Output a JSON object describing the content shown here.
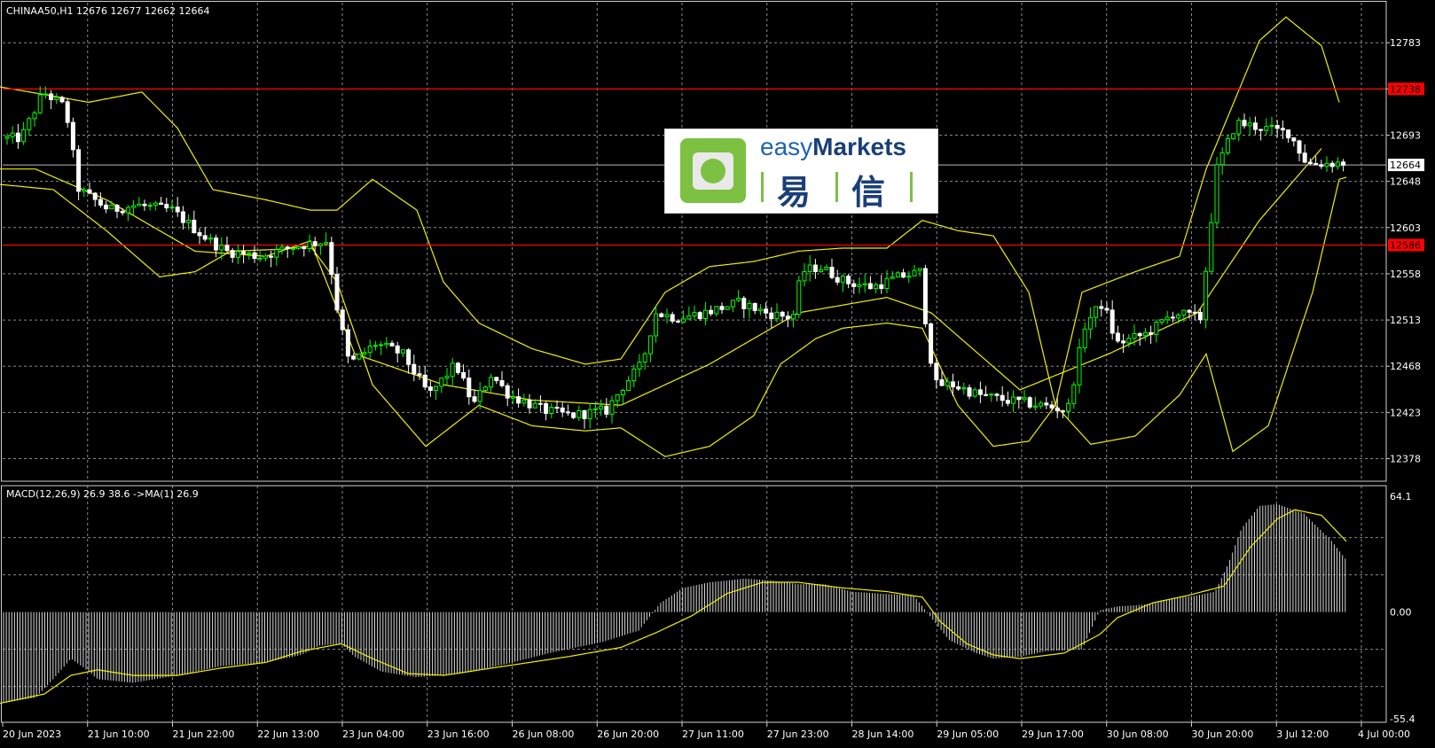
{
  "chart_data": [
    {
      "type": "candlestick",
      "title": "CHINAA50,H1  12676 12677 12662 12664",
      "price_ticks": [
        "12783",
        "12738",
        "12693",
        "12648",
        "12603",
        "12558",
        "12513",
        "12468",
        "12423",
        "12378"
      ],
      "ylim": [
        12356,
        12822
      ],
      "current_price": "12664",
      "levels": [
        {
          "label": "12738",
          "value": 12738,
          "color": "#ff0000"
        },
        {
          "label": "12586",
          "value": 12586,
          "color": "#ff0000"
        }
      ],
      "x_labels": [
        "20 Jun 2023",
        "21 Jun 10:00",
        "21 Jun 22:00",
        "22 Jun 13:00",
        "23 Jun 04:00",
        "23 Jun 16:00",
        "26 Jun 08:00",
        "26 Jun 20:00",
        "27 Jun 11:00",
        "27 Jun 23:00",
        "28 Jun 14:00",
        "29 Jun 05:00",
        "29 Jun 17:00",
        "30 Jun 08:00",
        "30 Jun 20:00",
        "3 Jul 12:00",
        "4 Jul 00:00"
      ],
      "bollinger_anchors": {
        "middle": [
          [
            0,
            12660
          ],
          [
            40,
            12660
          ],
          [
            120,
            12630
          ],
          [
            220,
            12580
          ],
          [
            300,
            12575
          ],
          [
            350,
            12590
          ],
          [
            400,
            12480
          ],
          [
            500,
            12450
          ],
          [
            600,
            12435
          ],
          [
            700,
            12430
          ],
          [
            800,
            12470
          ],
          [
            900,
            12520
          ],
          [
            1000,
            12535
          ],
          [
            1050,
            12520
          ],
          [
            1150,
            12445
          ],
          [
            1250,
            12480
          ],
          [
            1350,
            12520
          ],
          [
            1420,
            12610
          ],
          [
            1490,
            12680
          ]
        ],
        "upper": [
          [
            0,
            12740
          ],
          [
            100,
            12725
          ],
          [
            160,
            12735
          ],
          [
            200,
            12700
          ],
          [
            240,
            12640
          ],
          [
            300,
            12630
          ],
          [
            350,
            12620
          ],
          [
            380,
            12620
          ],
          [
            420,
            12650
          ],
          [
            470,
            12620
          ],
          [
            500,
            12550
          ],
          [
            540,
            12510
          ],
          [
            600,
            12485
          ],
          [
            660,
            12470
          ],
          [
            700,
            12475
          ],
          [
            750,
            12540
          ],
          [
            800,
            12565
          ],
          [
            850,
            12570
          ],
          [
            900,
            12580
          ],
          [
            950,
            12583
          ],
          [
            1000,
            12583
          ],
          [
            1040,
            12610
          ],
          [
            1080,
            12600
          ],
          [
            1120,
            12595
          ],
          [
            1160,
            12540
          ],
          [
            1190,
            12430
          ],
          [
            1220,
            12540
          ],
          [
            1280,
            12560
          ],
          [
            1330,
            12575
          ],
          [
            1360,
            12660
          ],
          [
            1420,
            12785
          ],
          [
            1450,
            12808
          ],
          [
            1490,
            12780
          ],
          [
            1510,
            12725
          ]
        ],
        "lower": [
          [
            0,
            12645
          ],
          [
            60,
            12640
          ],
          [
            120,
            12600
          ],
          [
            180,
            12555
          ],
          [
            220,
            12560
          ],
          [
            260,
            12580
          ],
          [
            320,
            12582
          ],
          [
            350,
            12585
          ],
          [
            380,
            12550
          ],
          [
            420,
            12450
          ],
          [
            480,
            12390
          ],
          [
            540,
            12430
          ],
          [
            600,
            12410
          ],
          [
            660,
            12405
          ],
          [
            700,
            12408
          ],
          [
            750,
            12380
          ],
          [
            800,
            12390
          ],
          [
            850,
            12420
          ],
          [
            880,
            12470
          ],
          [
            920,
            12495
          ],
          [
            950,
            12505
          ],
          [
            1000,
            12510
          ],
          [
            1040,
            12505
          ],
          [
            1080,
            12430
          ],
          [
            1120,
            12390
          ],
          [
            1160,
            12395
          ],
          [
            1190,
            12430
          ],
          [
            1230,
            12392
          ],
          [
            1280,
            12400
          ],
          [
            1330,
            12440
          ],
          [
            1360,
            12480
          ],
          [
            1390,
            12385
          ],
          [
            1430,
            12410
          ],
          [
            1480,
            12540
          ],
          [
            1510,
            12650
          ],
          [
            1518,
            12652
          ]
        ]
      },
      "candle_anchors": [
        [
          0,
          12690
        ],
        [
          30,
          12690
        ],
        [
          55,
          12735
        ],
        [
          80,
          12720
        ],
        [
          95,
          12640
        ],
        [
          130,
          12620
        ],
        [
          160,
          12625
        ],
        [
          200,
          12620
        ],
        [
          235,
          12595
        ],
        [
          260,
          12580
        ],
        [
          300,
          12575
        ],
        [
          340,
          12585
        ],
        [
          375,
          12590
        ],
        [
          385,
          12530
        ],
        [
          400,
          12470
        ],
        [
          430,
          12490
        ],
        [
          460,
          12480
        ],
        [
          490,
          12440
        ],
        [
          520,
          12470
        ],
        [
          540,
          12430
        ],
        [
          560,
          12460
        ],
        [
          580,
          12440
        ],
        [
          620,
          12425
        ],
        [
          650,
          12420
        ],
        [
          690,
          12425
        ],
        [
          710,
          12450
        ],
        [
          730,
          12470
        ],
        [
          745,
          12520
        ],
        [
          770,
          12515
        ],
        [
          800,
          12520
        ],
        [
          840,
          12530
        ],
        [
          870,
          12520
        ],
        [
          900,
          12515
        ],
        [
          910,
          12560
        ],
        [
          930,
          12565
        ],
        [
          960,
          12550
        ],
        [
          990,
          12545
        ],
        [
          1020,
          12555
        ],
        [
          1045,
          12560
        ],
        [
          1050,
          12510
        ],
        [
          1060,
          12450
        ],
        [
          1080,
          12450
        ],
        [
          1110,
          12440
        ],
        [
          1140,
          12435
        ],
        [
          1180,
          12430
        ],
        [
          1210,
          12425
        ],
        [
          1230,
          12510
        ],
        [
          1250,
          12530
        ],
        [
          1265,
          12490
        ],
        [
          1300,
          12500
        ],
        [
          1330,
          12520
        ],
        [
          1360,
          12515
        ],
        [
          1378,
          12660
        ],
        [
          1400,
          12705
        ],
        [
          1430,
          12700
        ],
        [
          1460,
          12695
        ],
        [
          1480,
          12665
        ],
        [
          1520,
          12666
        ]
      ]
    },
    {
      "type": "histogram",
      "title": "MACD(12,26,9) 26.9 38.6  ->MA(1) 26.9",
      "y_ticks": [
        "64.1",
        "0.00",
        "-55.4"
      ],
      "ylim": [
        -55.4,
        64.1
      ],
      "macd_anchors": [
        [
          0,
          -49
        ],
        [
          40,
          -46
        ],
        [
          60,
          -36
        ],
        [
          80,
          -25
        ],
        [
          95,
          -30
        ],
        [
          110,
          -36
        ],
        [
          150,
          -38
        ],
        [
          200,
          -34
        ],
        [
          250,
          -29
        ],
        [
          300,
          -27
        ],
        [
          340,
          -23
        ],
        [
          360,
          -18
        ],
        [
          385,
          -17
        ],
        [
          400,
          -24
        ],
        [
          430,
          -32
        ],
        [
          470,
          -35
        ],
        [
          520,
          -33
        ],
        [
          570,
          -28
        ],
        [
          620,
          -22
        ],
        [
          680,
          -16
        ],
        [
          720,
          -10
        ],
        [
          745,
          5
        ],
        [
          770,
          13
        ],
        [
          800,
          16
        ],
        [
          840,
          18
        ],
        [
          870,
          17
        ],
        [
          900,
          15
        ],
        [
          930,
          15
        ],
        [
          960,
          11
        ],
        [
          990,
          10
        ],
        [
          1030,
          9
        ],
        [
          1050,
          -3
        ],
        [
          1070,
          -15
        ],
        [
          1100,
          -22
        ],
        [
          1120,
          -25
        ],
        [
          1150,
          -24
        ],
        [
          1180,
          -21
        ],
        [
          1220,
          -20
        ],
        [
          1240,
          1
        ],
        [
          1260,
          3
        ],
        [
          1290,
          4
        ],
        [
          1320,
          7
        ],
        [
          1350,
          9
        ],
        [
          1370,
          11
        ],
        [
          1385,
          26
        ],
        [
          1400,
          45
        ],
        [
          1420,
          57
        ],
        [
          1440,
          58
        ],
        [
          1470,
          53
        ],
        [
          1500,
          39
        ],
        [
          1518,
          28
        ]
      ],
      "signal_anchors": [
        [
          0,
          -49
        ],
        [
          50,
          -44
        ],
        [
          80,
          -34
        ],
        [
          110,
          -31
        ],
        [
          150,
          -34
        ],
        [
          200,
          -34
        ],
        [
          250,
          -30
        ],
        [
          300,
          -27
        ],
        [
          340,
          -21
        ],
        [
          385,
          -17
        ],
        [
          420,
          -25
        ],
        [
          460,
          -33
        ],
        [
          500,
          -34
        ],
        [
          570,
          -29
        ],
        [
          640,
          -24
        ],
        [
          700,
          -19
        ],
        [
          740,
          -11
        ],
        [
          780,
          -2
        ],
        [
          820,
          10
        ],
        [
          860,
          16
        ],
        [
          900,
          16
        ],
        [
          950,
          13
        ],
        [
          1000,
          11
        ],
        [
          1040,
          8
        ],
        [
          1060,
          -5
        ],
        [
          1090,
          -17
        ],
        [
          1120,
          -23
        ],
        [
          1150,
          -25
        ],
        [
          1200,
          -22
        ],
        [
          1240,
          -12
        ],
        [
          1260,
          -3
        ],
        [
          1300,
          5
        ],
        [
          1340,
          9
        ],
        [
          1380,
          14
        ],
        [
          1410,
          35
        ],
        [
          1440,
          50
        ],
        [
          1460,
          55
        ],
        [
          1490,
          52
        ],
        [
          1518,
          38
        ]
      ]
    }
  ],
  "logo": {
    "brand_part1": "easy",
    "brand_part2": "Markets",
    "cn_char1": "易",
    "cn_char2": "信"
  },
  "colors": {
    "background": "#000000",
    "grid": "#8a8a8a",
    "bull_candle": "#00ff00",
    "bear_candle": "#ffffff",
    "bollinger": "#f0f000",
    "level_line": "#ff0000",
    "current_price_line": "#b8b8b8",
    "macd_hist": "#d8d8d8",
    "signal": "#f0f000"
  }
}
